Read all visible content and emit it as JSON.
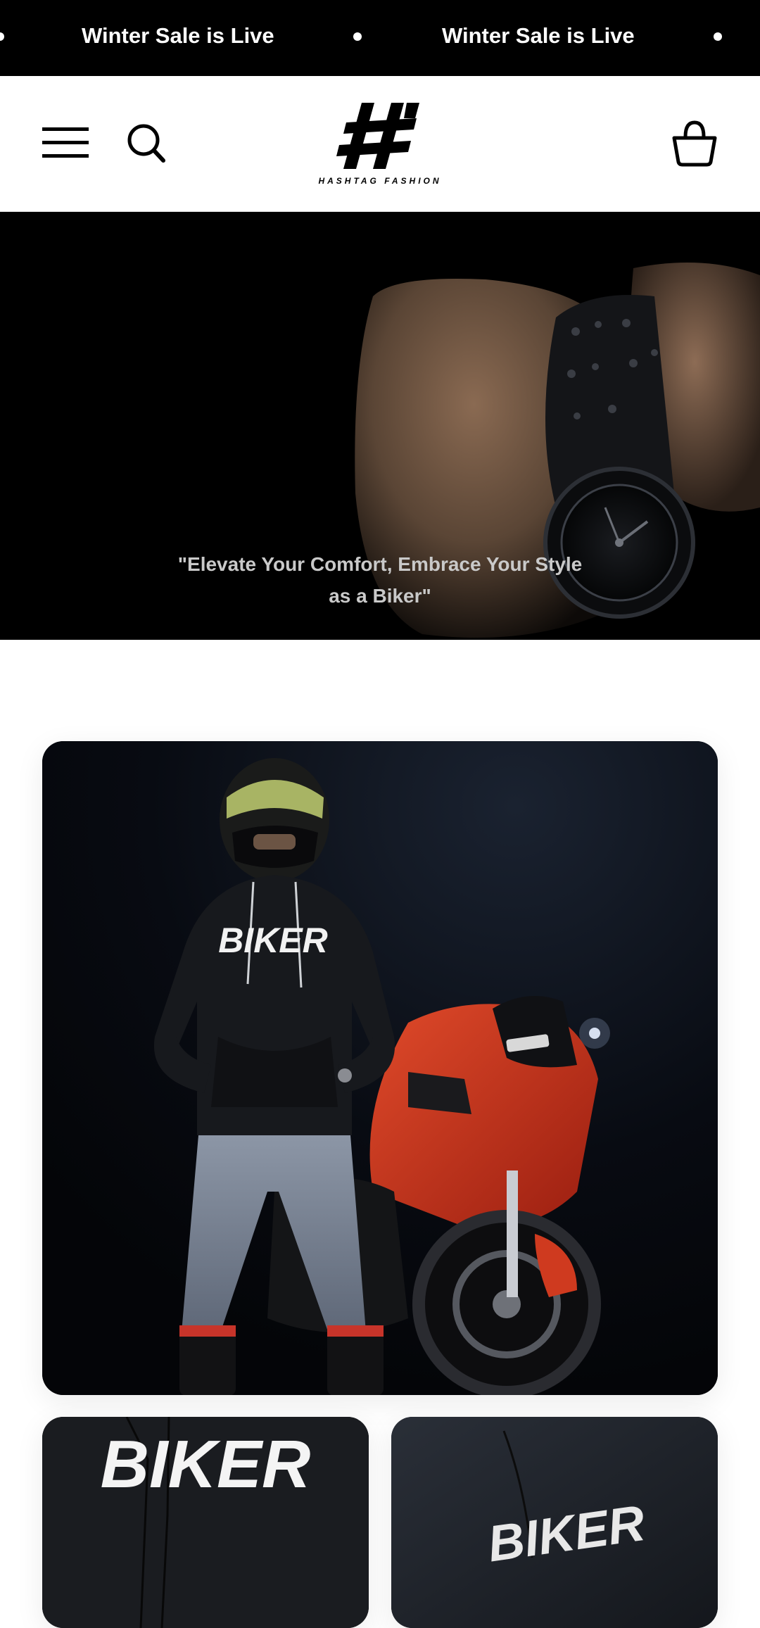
{
  "announcement": {
    "messages": [
      "Winter Sale is Live",
      "Winter Sale is Live"
    ]
  },
  "header": {
    "logo_text": "HASHTAG FASHION",
    "icons": [
      "menu-icon",
      "search-icon",
      "logo",
      "cart-icon"
    ]
  },
  "hero": {
    "quote": "\"Elevate Your Comfort, Embrace Your Style as a Biker\""
  },
  "products": {
    "main_print": "BIKER",
    "left_print": "BIKER",
    "right_print": "BIKER"
  },
  "colors": {
    "bar": "#000000",
    "accent_red": "#d0321e",
    "shirt": "#17191d"
  }
}
